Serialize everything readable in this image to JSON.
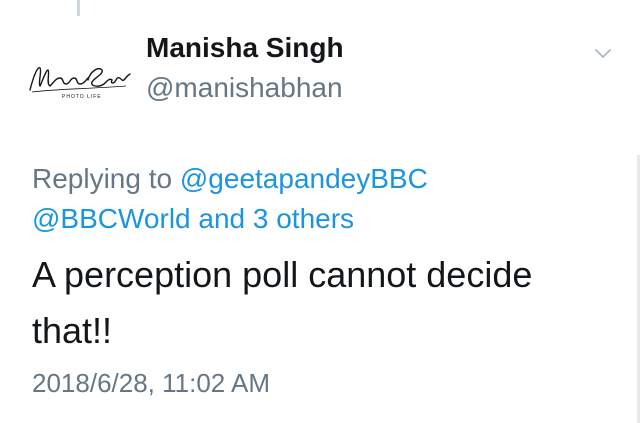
{
  "tweet": {
    "display_name": "Manisha Singh",
    "handle": "@manishabhan",
    "avatar_signature": "Manisha Singh",
    "avatar_caption": "Photo Life",
    "replying_prefix": "Replying to",
    "reply_mention_1": "@geetapandeyBBC",
    "reply_mention_2": "@BBCWorld",
    "reply_others": "and 3 others",
    "text": "A perception poll cannot decide that!!",
    "timestamp": "2018/6/28, 11:02 AM"
  },
  "icons": {
    "menu": "chevron-down-icon"
  },
  "colors": {
    "link": "#1b95e0",
    "secondary_text": "#657786",
    "primary_text": "#14171a"
  }
}
